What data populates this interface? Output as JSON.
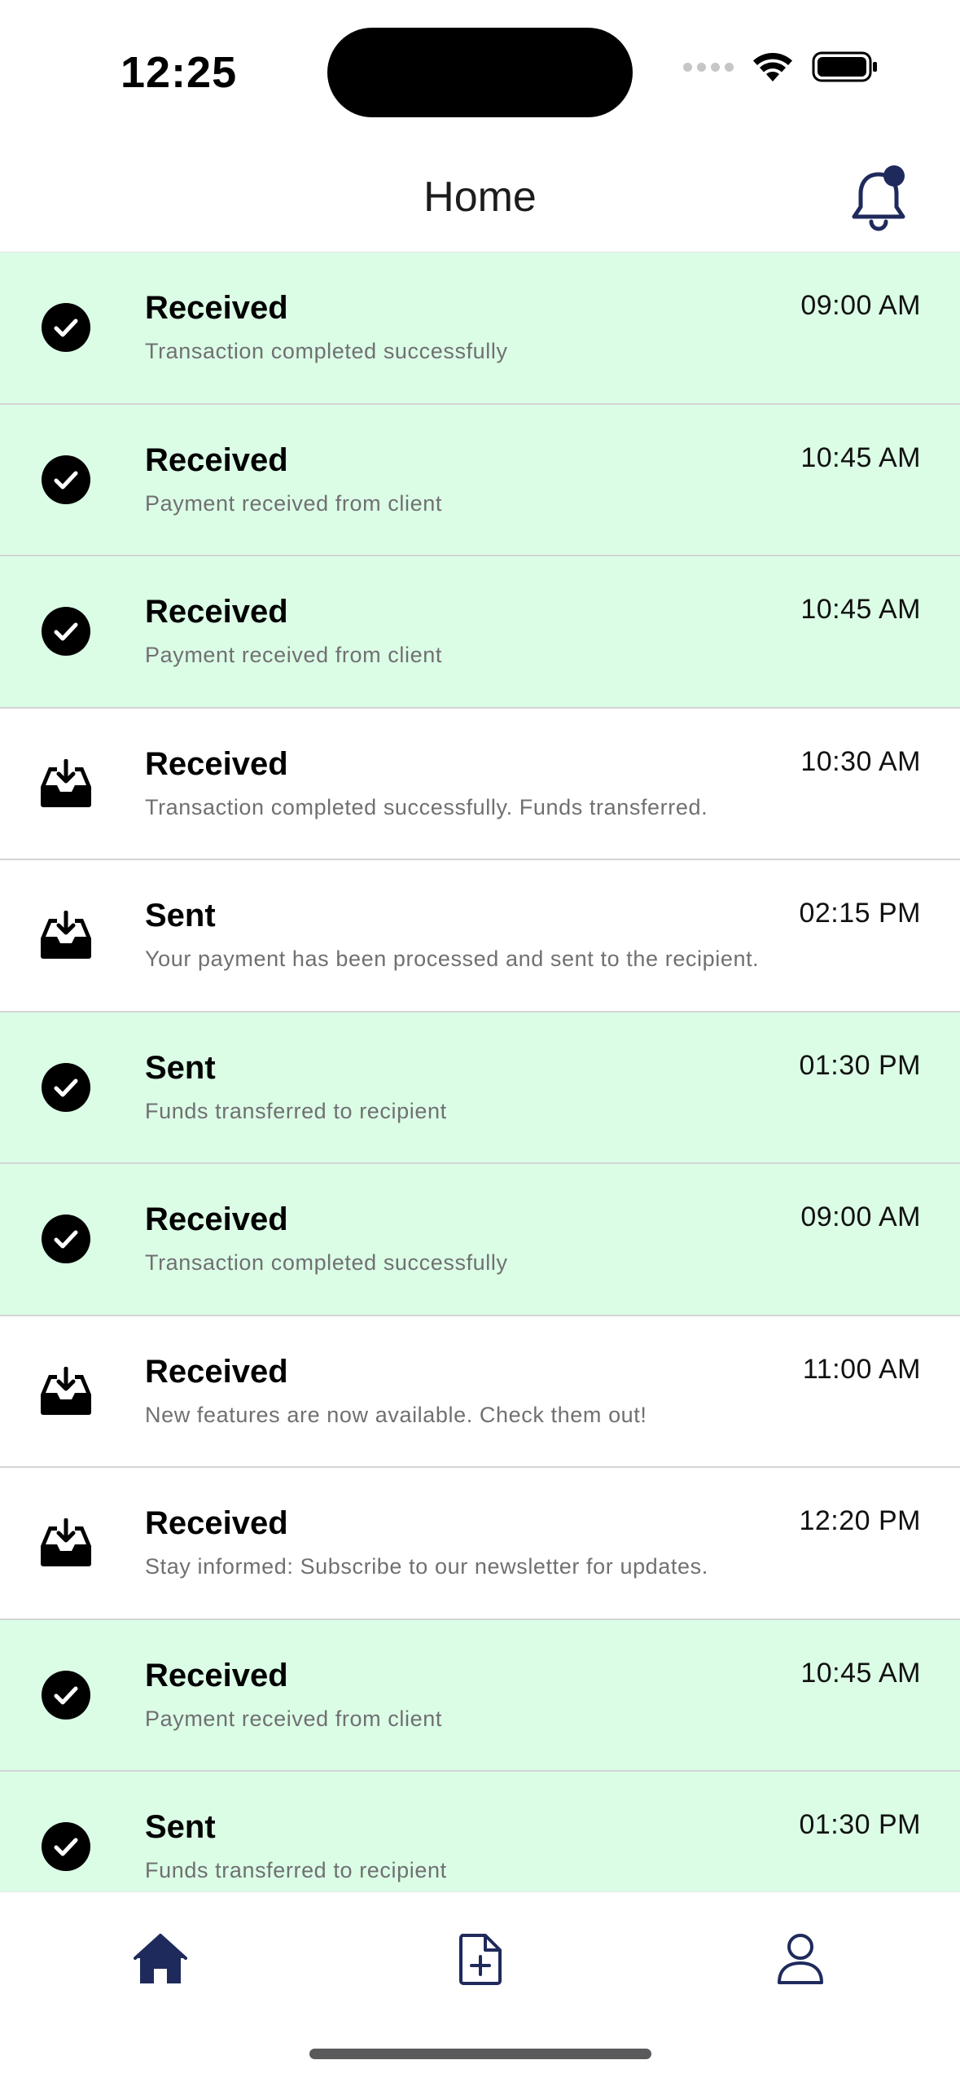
{
  "status_bar": {
    "time": "12:25"
  },
  "header": {
    "title": "Home",
    "bell_icon": "bell-icon",
    "has_notification_dot": true
  },
  "colors": {
    "accent": "#1f2a5c",
    "highlight_row": "#dbfde6",
    "text_secondary": "#707072"
  },
  "items": [
    {
      "status": "check",
      "highlight": true,
      "title": "Received",
      "subtitle": "Transaction completed successfully",
      "time": "09:00 AM"
    },
    {
      "status": "check",
      "highlight": true,
      "title": "Received",
      "subtitle": "Payment received from client",
      "time": "10:45 AM"
    },
    {
      "status": "check",
      "highlight": true,
      "title": "Received",
      "subtitle": "Payment received from client",
      "time": "10:45 AM"
    },
    {
      "status": "inbox",
      "highlight": false,
      "title": "Received",
      "subtitle": "Transaction completed successfully. Funds transferred.",
      "time": "10:30 AM"
    },
    {
      "status": "inbox",
      "highlight": false,
      "title": "Sent",
      "subtitle": "Your payment has been processed and sent to the recipient.",
      "time": "02:15 PM"
    },
    {
      "status": "check",
      "highlight": true,
      "title": "Sent",
      "subtitle": "Funds transferred to recipient",
      "time": "01:30 PM"
    },
    {
      "status": "check",
      "highlight": true,
      "title": "Received",
      "subtitle": "Transaction completed successfully",
      "time": "09:00 AM"
    },
    {
      "status": "inbox",
      "highlight": false,
      "title": "Received",
      "subtitle": "New features are now available. Check them out!",
      "time": "11:00 AM"
    },
    {
      "status": "inbox",
      "highlight": false,
      "title": "Received",
      "subtitle": "Stay informed: Subscribe to our newsletter for updates.",
      "time": "12:20 PM"
    },
    {
      "status": "check",
      "highlight": true,
      "title": "Received",
      "subtitle": "Payment received from client",
      "time": "10:45 AM"
    },
    {
      "status": "check",
      "highlight": true,
      "title": "Sent",
      "subtitle": "Funds transferred to recipient",
      "time": "01:30 PM"
    }
  ],
  "tab_bar": {
    "tabs": [
      {
        "icon": "home-icon",
        "active": true
      },
      {
        "icon": "new-document-icon",
        "active": false
      },
      {
        "icon": "profile-icon",
        "active": false
      }
    ]
  }
}
